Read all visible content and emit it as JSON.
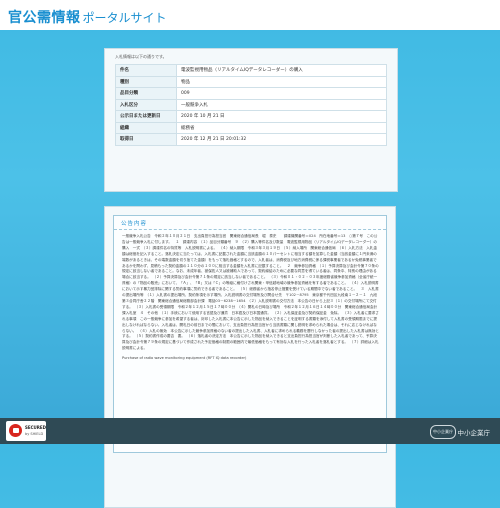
{
  "header": {
    "title_main": "官公需情報",
    "title_sub": "ポータルサイト"
  },
  "detail": {
    "intro": "入札情報は以下の通りです。",
    "rows": [
      {
        "label": "件名",
        "value": "電波監視用物品（リアルタイムIQデータレコーダー）の購入"
      },
      {
        "label": "種別",
        "value": "物品"
      },
      {
        "label": "品目分類",
        "value": "009"
      },
      {
        "label": "入札区分",
        "value": "一般競争入札"
      },
      {
        "label": "公示日または更新日",
        "value": "2020 年 10 月 21 日"
      },
      {
        "label": "組織",
        "value": "総務省"
      },
      {
        "label": "取得日",
        "value": "2020 年 12 月 21 日 20:01:32"
      }
    ]
  },
  "notice": {
    "title": "公告内容",
    "body": "一般競争入札公告　令和２年１０月２１日　支出負担行為担当官　関東総合通信局長　堀　泰史　　調達機関番号＝024　所在地番号＝13　○第７号　この公告は一般競争入札に付します。　１　調達内容　（１）品目分類番号　９　（２）購入等件名及び数量　電波監視用物品（リアルタイムIQデータレコーダー）の購入　一式　（３）調達件名の特質等　入札説明書による。　（４）納入期限　令和３年３月１９日　（５）納入場所　関東総合通信局　（６）入札方法　入札金額は総価を記入すること。落札決定に当たっては、入札書に記載された金額に当該金額の１０パーセントに相当する額を加算した金額（当該金額に１円未満の端数があるときは、その端数金額を切り捨てた金額）をもって落札価格とするので、入札者は、消費税及び地方消費税に係る課税事業者であるか免税事業者であるかを問わず、見積もった契約金額の１１０分の１００に相当する金額を入札書に記載すること。　２　競争参加資格　（１）予算決算及び会計令第７０条の規定に該当しない者であること。なお、未成年者、被保佐人又は被補助人であって、契約締結のために必要な同意を得ている者は、同条中、特別の理由がある場合に該当する。　（２）予算決算及び会計令第７１条の規定に該当しない者であること。　（３）令和０１・０２・０３年度総務省競争参加資格（全省庁統一資格）の「物品の販売」において、「Ａ」、「Ｂ」又は「Ｃ」の等級に格付けされ関東・甲信越地域の競争参加資格を有する者であること。　（４）入札説明書において示す暴力団排除に関する誓約事項に誓約できる者であること。　（５）総務省から指名停止措置を受けている期間中でない者であること。　３　入札書の提出場所等　（１）入札書の提出場所、契約条項を示す場所、入札説明書の交付場所及び問合せ先　〒102－8795　東京都千代田区九段南１－２－１　九段第３合同庁舎２２階　関東総合通信局総務部会計課　電話03－6238－1654　（２）入札説明書の交付方法　本公告の日から上記３（１）の交付場所にて交付する。　（３）入札書の受領期限　令和２年１２月１５日１７時００分　（４）開札の日時及び場所　令和２年１２月１６日１４時００分　関東総合通信局会計課入札室　４　その他　（１）手続において使用する言語及び通貨　日本語及び日本国通貨。　（２）入札保証金及び契約保証金　免除。　（３）入札者に要求される事項　この一般競争に参加を希望する者は、封印した入札書に本公告に示した物品を納入できることを証明する書類を添付して入札書の受領期限までに提出しなければならない。入札者は、開札日の前日までの間において、支出負担行為担当官から当該書類に関し説明を求められた場合は、それに応じなければならない。　（４）入札の無効　本公告に示した競争参加資格のない者の提出した入札書、入札者に求められる義務を履行しなかった者の提出した入札書は無効とする。　（５）契約書作成の要否　要。　（６）落札者の決定方法　本公告に示した物品を納入できると支出負担行為担当官が判断した入札者であって、予算決算及び会計令第７９条の規定に基づいて作成された予定価格の制限の範囲内で最低価格をもって有効な入札を行った入札者を落札者とする。　（７）詳細は入札説明書による。",
    "body_en": "Purchase of radio wave monitoring equipment (RFT IQ data recorder)"
  },
  "footer": {
    "badge_title": "SECURED",
    "badge_sub": "by SHIELD",
    "org_logo_text": "中小企業庁",
    "org_name": "中小企業庁"
  },
  "colors": {
    "brand_blue": "#1a8fd0",
    "background_cyan": "#3fb9e3",
    "footer_dark": "#2f4a55",
    "badge_red": "#d8261e"
  }
}
